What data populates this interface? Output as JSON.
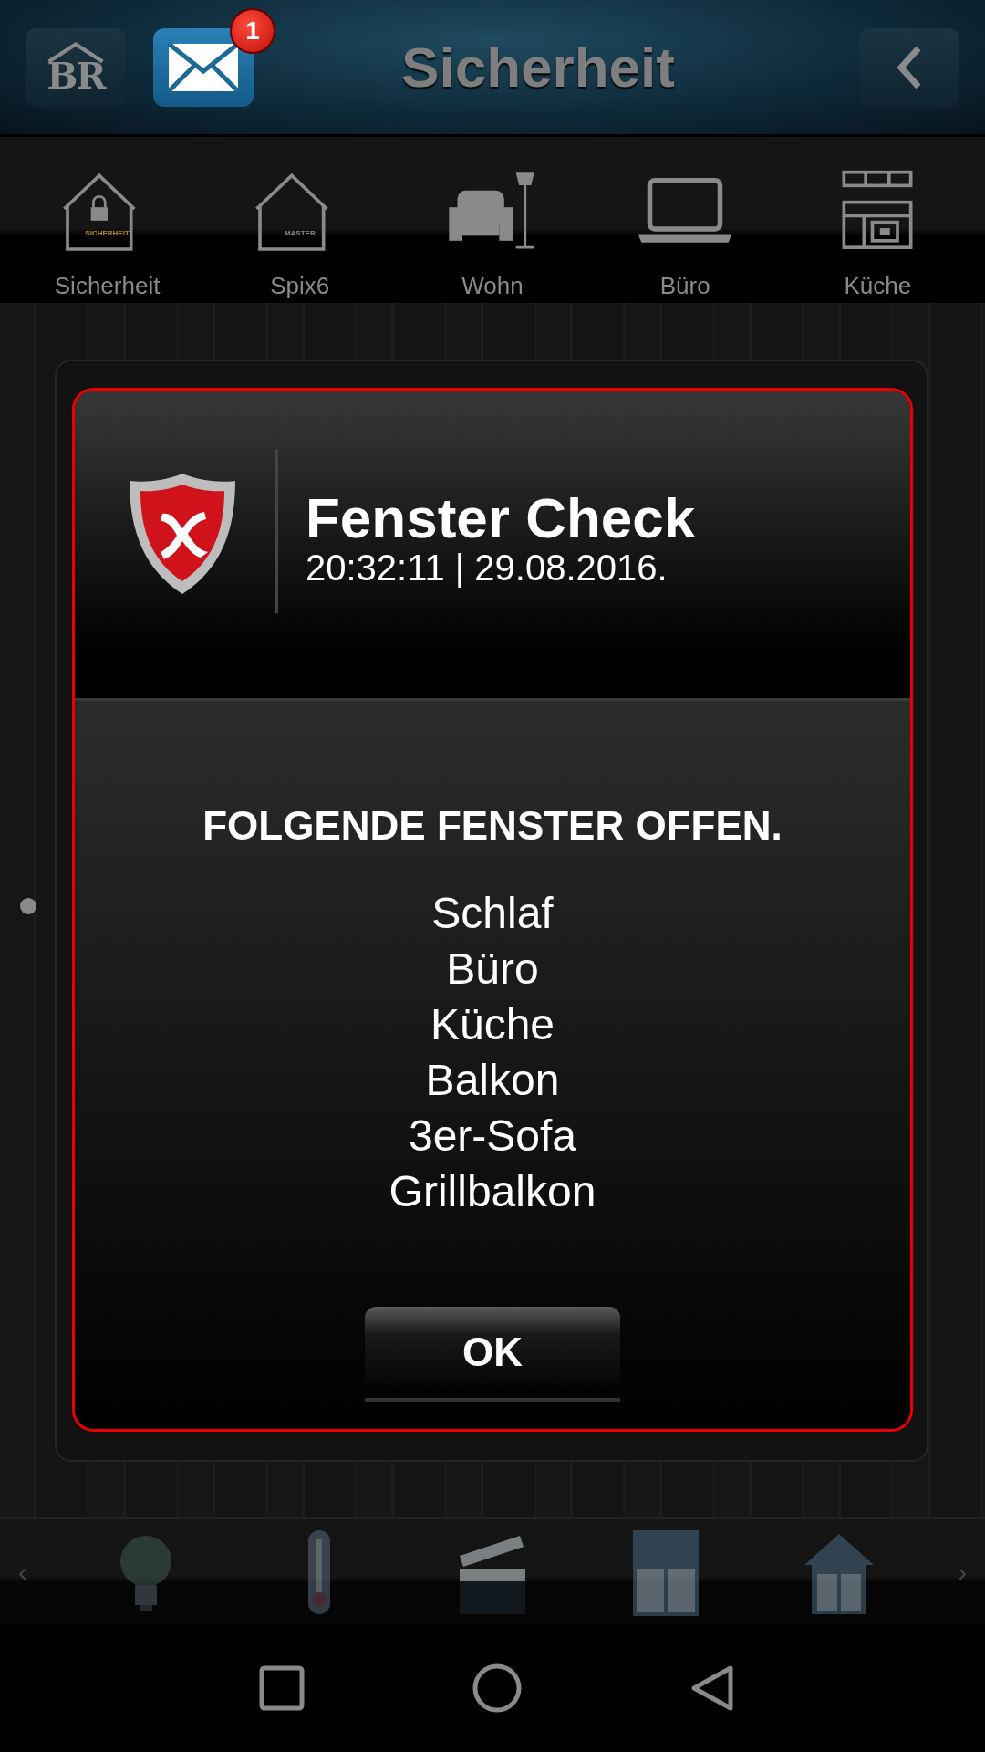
{
  "top_bar": {
    "logo_text": "BR",
    "mail_badge": "1",
    "title": "Sicherheit"
  },
  "rooms": [
    {
      "kind": "secure-house",
      "label": "Sicherheit",
      "icon_label": "SICHERHEIT"
    },
    {
      "kind": "house",
      "label": "Spix6",
      "icon_label": "MASTER"
    },
    {
      "kind": "armchair",
      "label": "Wohn"
    },
    {
      "kind": "laptop",
      "label": "Büro"
    },
    {
      "kind": "kitchen",
      "label": "Küche"
    }
  ],
  "dialog": {
    "title": "Fenster Check",
    "timestamp": "20:32:11 | 29.08.2016.",
    "heading": "FOLGENDE FENSTER OFFEN.",
    "windows": [
      "Schlaf",
      "Büro",
      "Küche",
      "Balkon",
      "3er-Sofa",
      "Grillbalkon"
    ],
    "button": "OK"
  },
  "dock": {
    "prev": "‹",
    "next": "›",
    "items": [
      {
        "kind": "bulb"
      },
      {
        "kind": "thermometer"
      },
      {
        "kind": "clapperboard"
      },
      {
        "kind": "shutter"
      },
      {
        "kind": "house"
      }
    ]
  }
}
